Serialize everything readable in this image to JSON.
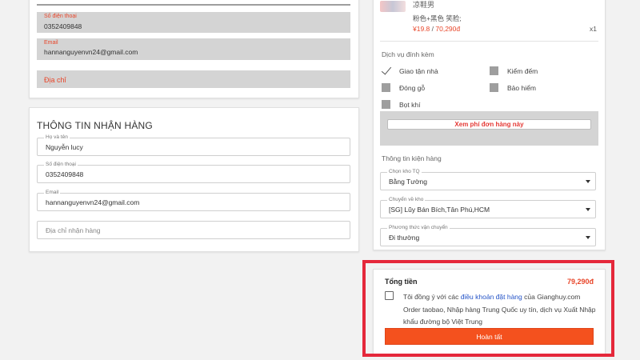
{
  "sender": {
    "phone_label": "Số điện thoại",
    "phone_value": "0352409848",
    "email_label": "Email",
    "email_value": "hannanguyenvn24@gmail.com",
    "address_placeholder": "Địa chỉ"
  },
  "receiver": {
    "title": "THÔNG TIN NHẬN HÀNG",
    "name_label": "Họ và tên",
    "name_value": "Nguyễn lucy",
    "phone_label": "Số điện thoại",
    "phone_value": "0352409848",
    "email_label": "Email",
    "email_value": "hannanguyenvn24@gmail.com",
    "address_placeholder": "Địa chỉ nhận hàng"
  },
  "product": {
    "name": "凉鞋男",
    "variant": "粉色+黑色 笑脸;",
    "price_cny": "¥19.8",
    "price_sep": " / ",
    "price_vnd": "70,290đ",
    "qty": "x1"
  },
  "services": {
    "title": "Dịch vụ đính kèm",
    "items": [
      {
        "label": "Giao tận nhà",
        "checked": true
      },
      {
        "label": "Kiểm đếm",
        "checked": false
      },
      {
        "label": "Đóng gỗ",
        "checked": false
      },
      {
        "label": "Bảo hiểm",
        "checked": false
      },
      {
        "label": "Bọt khí",
        "checked": false
      }
    ],
    "fee_button": "Xem phí đơn hàng này"
  },
  "shipping": {
    "title": "Thông tin kiện hàng",
    "warehouse_label": "Chọn kho TQ",
    "warehouse_value": "Bằng Tường",
    "dest_label": "Chuyển về kho",
    "dest_value": "[SG] Lũy Bán Bích,Tân Phú,HCM",
    "method_label": "Phương thức vận chuyển",
    "method_value": "Đi thường"
  },
  "total": {
    "label": "Tổng tiền",
    "value": "79,290đ",
    "agree_prefix": "Tôi đồng ý với các ",
    "agree_link": "điều khoản đặt hàng",
    "agree_suffix": " của Gianghuy.com Order taobao, Nhập hàng Trung Quốc uy tín, dịch vụ Xuất Nhập khẩu đường bộ Việt Trung",
    "submit_label": "Hoàn tất"
  },
  "colors": {
    "accent": "#f4511e",
    "highlight_frame": "#e5283b",
    "price": "#e8462a"
  }
}
